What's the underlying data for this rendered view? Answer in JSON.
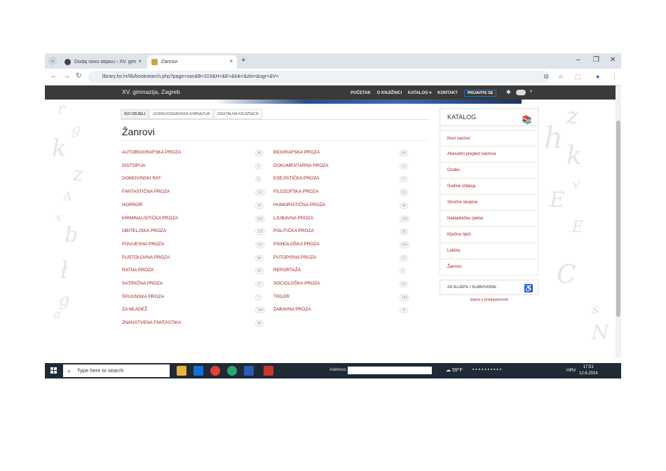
{
  "browser": {
    "tabs": [
      {
        "label": "Dodaj novu objavu ‹ XV. gimna",
        "close": "×"
      },
      {
        "label": "Žanrovi",
        "close": "×"
      }
    ],
    "new_tab": "+",
    "url": "library.foi.hr/lib/booksearch.php?page=zan&B=319&H=&E=&lok=&zbi=&ogr=&V=",
    "window_controls": [
      "–",
      "❐",
      "✕"
    ]
  },
  "site": {
    "name": "XV. gimnazija, Zagreb",
    "menu": [
      "POČETAK",
      "O KNJIŽNICI",
      "KATALOG ▾",
      "KONTAKT"
    ],
    "login": "PRIJAVITE SE"
  },
  "subtabs": [
    "SVI ODJELI",
    "GORNJOGRADSKA GIMNAZIJA",
    "DIGITALNA KNJIŽNICA"
  ],
  "page_title": "Žanrovi",
  "genres_left": [
    {
      "name": "Autobiografska proza",
      "count": "46"
    },
    {
      "name": "Distopija",
      "count": "1"
    },
    {
      "name": "Domovinski rat",
      "count": "6"
    },
    {
      "name": "Fantastična proza",
      "count": "111"
    },
    {
      "name": "Horror",
      "count": "36"
    },
    {
      "name": "Kriminalistička proza",
      "count": "500"
    },
    {
      "name": "Obiteljska proza",
      "count": "225"
    },
    {
      "name": "Povijesna proza",
      "count": "107"
    },
    {
      "name": "Pustolovna proza",
      "count": "98"
    },
    {
      "name": "Ratna proza",
      "count": "54"
    },
    {
      "name": "Satirična proza",
      "count": "17"
    },
    {
      "name": "Špijunska proza",
      "count": "7"
    },
    {
      "name": "Za mladež",
      "count": "184"
    },
    {
      "name": "Znanstvena fantastika",
      "count": "36"
    }
  ],
  "genres_right": [
    {
      "name": "Biografska proza",
      "count": "64"
    },
    {
      "name": "Dokumentarna proza",
      "count": "10"
    },
    {
      "name": "Esejistička proza",
      "count": "17"
    },
    {
      "name": "Filozofska proza",
      "count": "62"
    },
    {
      "name": "Humoristična proza",
      "count": "38"
    },
    {
      "name": "Ljubavna proza",
      "count": "200"
    },
    {
      "name": "Politička proza",
      "count": "28"
    },
    {
      "name": "Psihološka proza",
      "count": "554"
    },
    {
      "name": "Putopisna proza",
      "count": "21"
    },
    {
      "name": "Reportaža",
      "count": "1"
    },
    {
      "name": "Sociološka proza",
      "count": "63"
    },
    {
      "name": "Triler",
      "count": "183"
    },
    {
      "name": "Zabavna proza",
      "count": "76"
    }
  ],
  "sidebar": {
    "title": "KATALOG",
    "links": [
      "Novi naslovi",
      "Abecedni pregled naslova",
      "Osobe",
      "Godine izdanja",
      "Stručne skupine",
      "Nakladničke cjeline",
      "Ključne riječi",
      "Lektira",
      "Žanrovi"
    ],
    "blind": "ZA SLIJEPE I SLABOVIDNE",
    "accessibility": "Izjava o pristupačnosti"
  },
  "taskbar": {
    "search_placeholder": "Type here to search",
    "address_label": "Address",
    "weather": "59°F",
    "lang": "HRV",
    "time": "17:51",
    "date": "12.6.2024"
  },
  "colors": {
    "accent": "#9b1a1a",
    "nav": "#3a3a3a",
    "taskbar": "#1f2a36"
  }
}
